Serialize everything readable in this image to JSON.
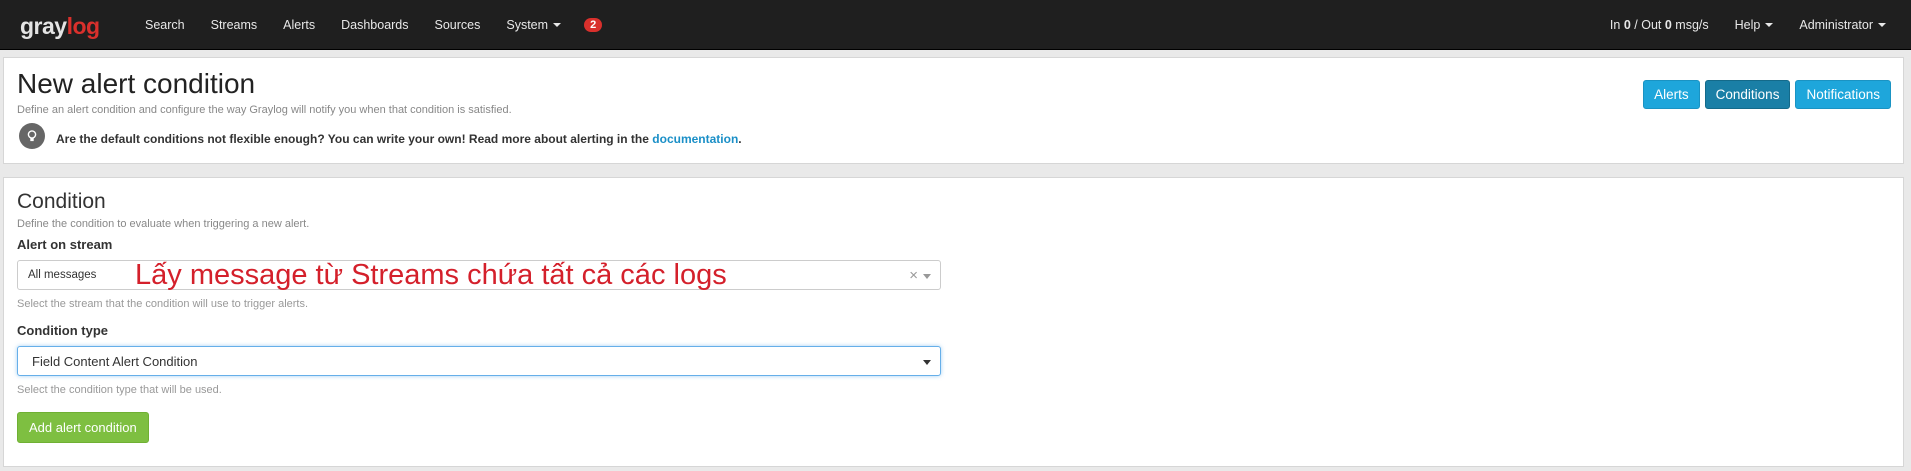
{
  "navbar": {
    "logo": {
      "part1": "gray",
      "part2": "log"
    },
    "items": [
      "Search",
      "Streams",
      "Alerts",
      "Dashboards",
      "Sources",
      "System"
    ],
    "badge": "2",
    "throughput": {
      "in_label": "In",
      "in_val": "0",
      "sep": "/ Out",
      "out_val": "0",
      "unit": "msg/s"
    },
    "help": "Help",
    "user": "Administrator"
  },
  "header": {
    "title": "New alert condition",
    "description": "Define an alert condition and configure the way Graylog will notify you when that condition is satisfied.",
    "tip": "Are the default conditions not flexible enough? You can write your own! Read more about alerting in the",
    "tip_link": "documentation",
    "tip_end": ".",
    "buttons": [
      "Alerts",
      "Conditions",
      "Notifications"
    ]
  },
  "condition": {
    "title": "Condition",
    "description": "Define the condition to evaluate when triggering a new alert.",
    "stream_label": "Alert on stream",
    "stream_value": "All messages",
    "stream_help": "Select the stream that the condition will use to trigger alerts.",
    "annotation": "Lấy message từ Streams chứa tất cả các logs",
    "type_label": "Condition type",
    "type_value": "Field Content Alert Condition",
    "type_help": "Select the condition type that will be used.",
    "submit": "Add alert condition"
  }
}
